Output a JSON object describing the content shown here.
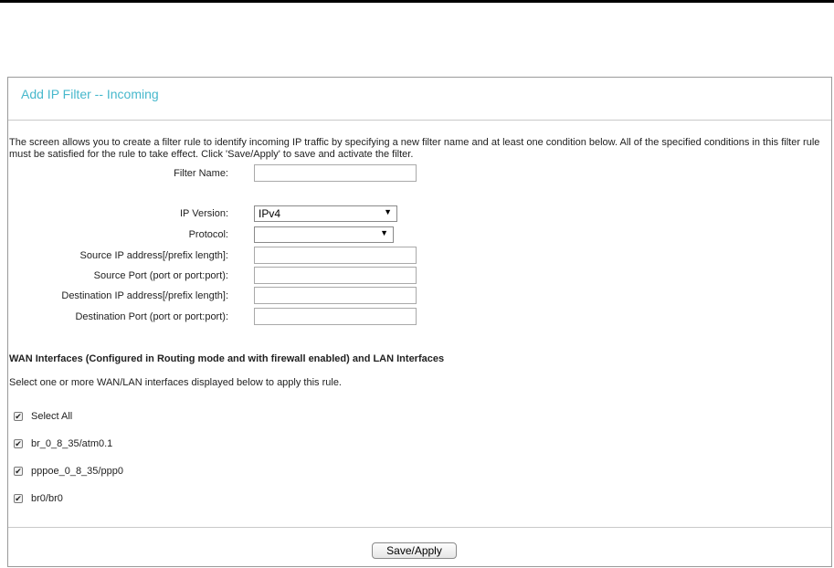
{
  "page": {
    "title": "Add IP Filter -- Incoming",
    "description": "The screen allows you to create a filter rule to identify incoming IP traffic by specifying a new filter name and at least one condition below. All of the specified conditions in this filter rule must be satisfied for the rule to take effect. Click 'Save/Apply' to save and activate the filter."
  },
  "form": {
    "filter_name_label": "Filter Name:",
    "filter_name_value": "",
    "ip_version_label": "IP Version:",
    "ip_version_value": "IPv4",
    "protocol_label": "Protocol:",
    "protocol_value": "",
    "source_ip_label": "Source IP address[/prefix length]:",
    "source_ip_value": "",
    "source_port_label": "Source Port (port or port:port):",
    "source_port_value": "",
    "dest_ip_label": "Destination IP address[/prefix length]:",
    "dest_ip_value": "",
    "dest_port_label": "Destination Port (port or port:port):",
    "dest_port_value": ""
  },
  "interfaces": {
    "heading": "WAN Interfaces (Configured in Routing mode and with firewall enabled) and LAN Interfaces",
    "instruction": "Select one or more WAN/LAN interfaces displayed below to apply this rule.",
    "items": [
      {
        "label": "Select All",
        "checked": true
      },
      {
        "label": "br_0_8_35/atm0.1",
        "checked": true
      },
      {
        "label": "pppoe_0_8_35/ppp0",
        "checked": true
      },
      {
        "label": "br0/br0",
        "checked": true
      }
    ]
  },
  "actions": {
    "save_label": "Save/Apply"
  },
  "colors": {
    "title": "#47b8cc",
    "border": "#9a9a9a"
  }
}
